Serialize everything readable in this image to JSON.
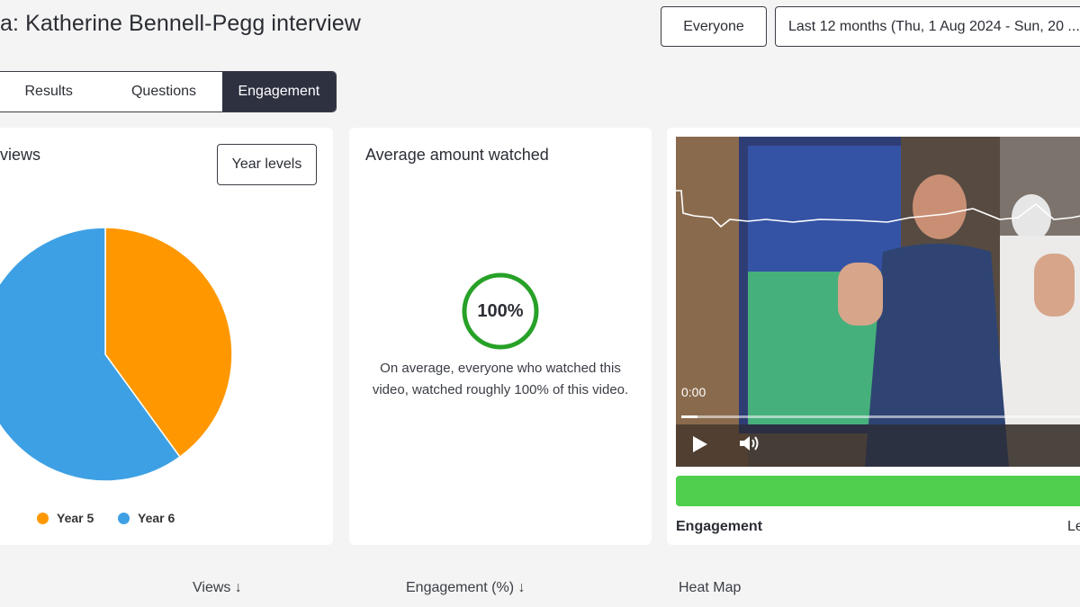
{
  "header": {
    "title": "a: Katherine Bennell-Pegg interview",
    "audience_filter": "Everyone",
    "date_range": "Last 12 months (Thu, 1 Aug 2024 - Sun, 20 ..."
  },
  "tabs": [
    {
      "label": "Results",
      "active": false
    },
    {
      "label": "Questions",
      "active": false
    },
    {
      "label": "Engagement",
      "active": true
    }
  ],
  "views_card": {
    "title": "views",
    "filter_button": "Year levels",
    "chart_data": {
      "type": "pie",
      "title": "",
      "slices": [
        {
          "label": "Year 5",
          "value": 40,
          "color": "#ff9800"
        },
        {
          "label": "Year 6",
          "value": 60,
          "color": "#3ea0e4"
        }
      ],
      "legend": "bottom"
    }
  },
  "avg_card": {
    "title": "Average amount watched",
    "percent_label": "100%",
    "percent_value": 100,
    "description": "On average, everyone who watched this video, watched roughly 100% of this video.",
    "ring_color": "#27a127"
  },
  "video_card": {
    "time": "0:00",
    "progress": 0.04,
    "engagement_label": "Engagement",
    "right_label": "Le",
    "bar_color": "#4fcf4d"
  },
  "table": {
    "columns": [
      "Views ↓",
      "Engagement (%) ↓",
      "Heat Map"
    ]
  }
}
